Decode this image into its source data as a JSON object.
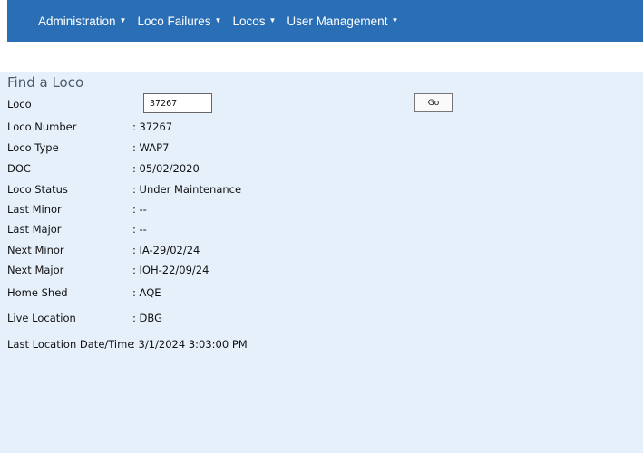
{
  "nav": {
    "items": [
      {
        "label": "Administration"
      },
      {
        "label": "Loco Failures"
      },
      {
        "label": "Locos"
      },
      {
        "label": "User Management"
      }
    ],
    "caret": "▼"
  },
  "find": {
    "title": "Find a Loco",
    "loco_label": "Loco",
    "loco_value": "37267",
    "go_label": "Go"
  },
  "details": [
    {
      "label": "Loco Number",
      "value": ": 37267"
    },
    {
      "label": "Loco Type",
      "value": ": WAP7"
    },
    {
      "label": "DOC",
      "value": ": 05/02/2020"
    },
    {
      "label": "Loco Status",
      "value": ": Under Maintenance"
    },
    {
      "label": "Last Minor",
      "value": ": --"
    },
    {
      "label": "Last Major",
      "value": ": --"
    },
    {
      "label": "Next Minor",
      "value": ": IA-29/02/24"
    },
    {
      "label": "Next Major",
      "value": ": IOH-22/09/24"
    },
    {
      "label": "Home Shed",
      "value": ": AQE"
    },
    {
      "label": "Live Location",
      "value": ": DBG"
    },
    {
      "label": "Last Location Date/Time",
      "value": ": 3/1/2024 3:03:00 PM"
    }
  ],
  "colors": {
    "navbar": "#2a6fb5",
    "panel": "#e6f0fb"
  }
}
